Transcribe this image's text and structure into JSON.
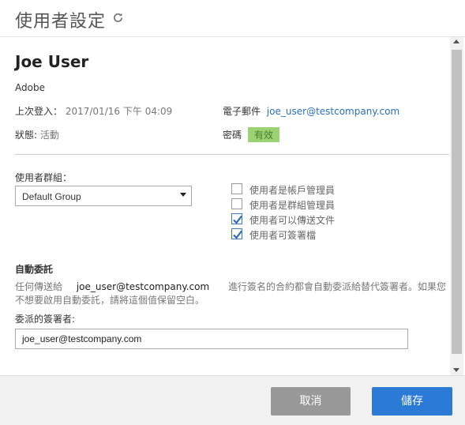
{
  "header": {
    "title": "使用者設定"
  },
  "user": {
    "name": "Joe User",
    "company": "Adobe",
    "last_login_label": "上次登入：",
    "last_login_date": "2017/01/16",
    "last_login_ampm": "下午",
    "last_login_time": "04:09",
    "email_label": "電子郵件",
    "email": "joe_user@testcompany.com",
    "status_label": "狀態:",
    "status_value": "活動",
    "password_label": "密碼",
    "password_value": "有效"
  },
  "group": {
    "label": "使用者群組：",
    "selected": "Default Group"
  },
  "permissions": [
    {
      "label": "使用者是帳戶管理員",
      "checked": false
    },
    {
      "label": "使用者是群組管理員",
      "checked": false
    },
    {
      "label": "使用者可以傳送文件",
      "checked": true
    },
    {
      "label": "使用者可簽署檔",
      "checked": true
    }
  ],
  "delegation": {
    "title": "自動委託",
    "desc_prefix": "任何傳送給",
    "desc_email": "joe_user@testcompany.com",
    "desc_suffix": "進行簽名的合約都會自動委派給替代簽署者。如果您",
    "desc_line2": "不想要啟用自動委託，請將這個值保留空白。",
    "delegate_label": "委派的簽署者:",
    "delegate_value": "joe_user@testcompany.com"
  },
  "footer": {
    "cancel_label": "取消",
    "save_label": "儲存"
  },
  "colors": {
    "accent": "#2b7bd6",
    "status_green": "#9bd374",
    "cancel_gray": "#999999"
  }
}
